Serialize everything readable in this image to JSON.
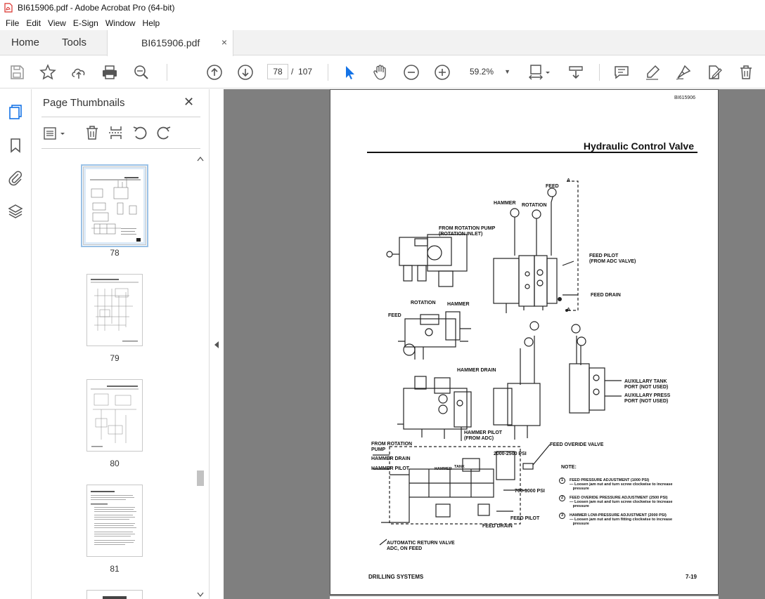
{
  "window": {
    "title": "BI615906.pdf - Adobe Acrobat Pro (64-bit)"
  },
  "menu": [
    "File",
    "Edit",
    "View",
    "E-Sign",
    "Window",
    "Help"
  ],
  "tabs": {
    "home": "Home",
    "tools": "Tools",
    "doc": "BI615906.pdf",
    "close": "×"
  },
  "toolbar": {
    "current_page": "78",
    "page_separator": "/",
    "total_pages": "107",
    "zoom": "59.2%"
  },
  "panel": {
    "title": "Page Thumbnails",
    "thumbnails": [
      {
        "label": "78",
        "selected": true
      },
      {
        "label": "79"
      },
      {
        "label": "80"
      },
      {
        "label": "81"
      }
    ]
  },
  "document": {
    "id": "BI615906",
    "title": "Hydraulic Control Valve",
    "footer_left": "DRILLING SYSTEMS",
    "footer_right": "7-19",
    "labels": {
      "feed": "FEED",
      "hammer": "HAMMER",
      "rotation": "ROTATION",
      "a_top": "A",
      "a_bottom": "A",
      "from_rotation_pump": "FROM ROTATION PUMP\n(ROTATION INLET)",
      "feed_pilot": "FEED PILOT\n(FROM ADC VALVE)",
      "feed_drain": "FEED DRAIN",
      "rotation2": "ROTATION",
      "hammer2": "HAMMER",
      "feed2": "FEED",
      "hammer_drain": "HAMMER DRAIN",
      "aux_tank": "AUXILLARY TANK\nPORT (NOT USED)",
      "aux_press": "AUXILLARY PRESS\nPORT (NOT USED)",
      "hammer_pilot_adc": "HAMMER PILOT\n(FROM ADC)",
      "from_rotation_pump2": "FROM ROTATION\nPUMP",
      "psi_2000": "2000-2500 PSI",
      "feed_overide_valve": "FEED OVERIDE VALVE",
      "hammer_drain2": "HAMMER DRAIN",
      "hammer_pilot2": "HAMMER PILOT",
      "psi_700": "700-1000 PSI",
      "feed_pilot2": "FEED PILOT",
      "feed_drain2": "FEED DRAIN",
      "auto_return": "AUTOMATIC RETURN VALVE\nADC, ON FEED",
      "note": "NOTE:",
      "note1": "FEED PRESSURE ADJUSTMENT (1000 PSI)\n— Loosen jam nut and turn screw clockwise to increase\n   pressure",
      "note2": "FEED OVERIDE PRESSURE ADJUSTMENT (2500 PSI)\n— Loosen jam nut and turn screw clockwise to increase\n   pressure",
      "note3": "HAMMER LOW-PRESSURE ADJUSTMENT (2000 PSI)\n— Loosen jam nut and turn fitting clockwise to increase\n   pressure",
      "hammer_small": "HAMMER",
      "tank_small": "TANK"
    }
  },
  "colors": {
    "accent": "#1473e6",
    "pdf_icon": "#d9302b"
  }
}
